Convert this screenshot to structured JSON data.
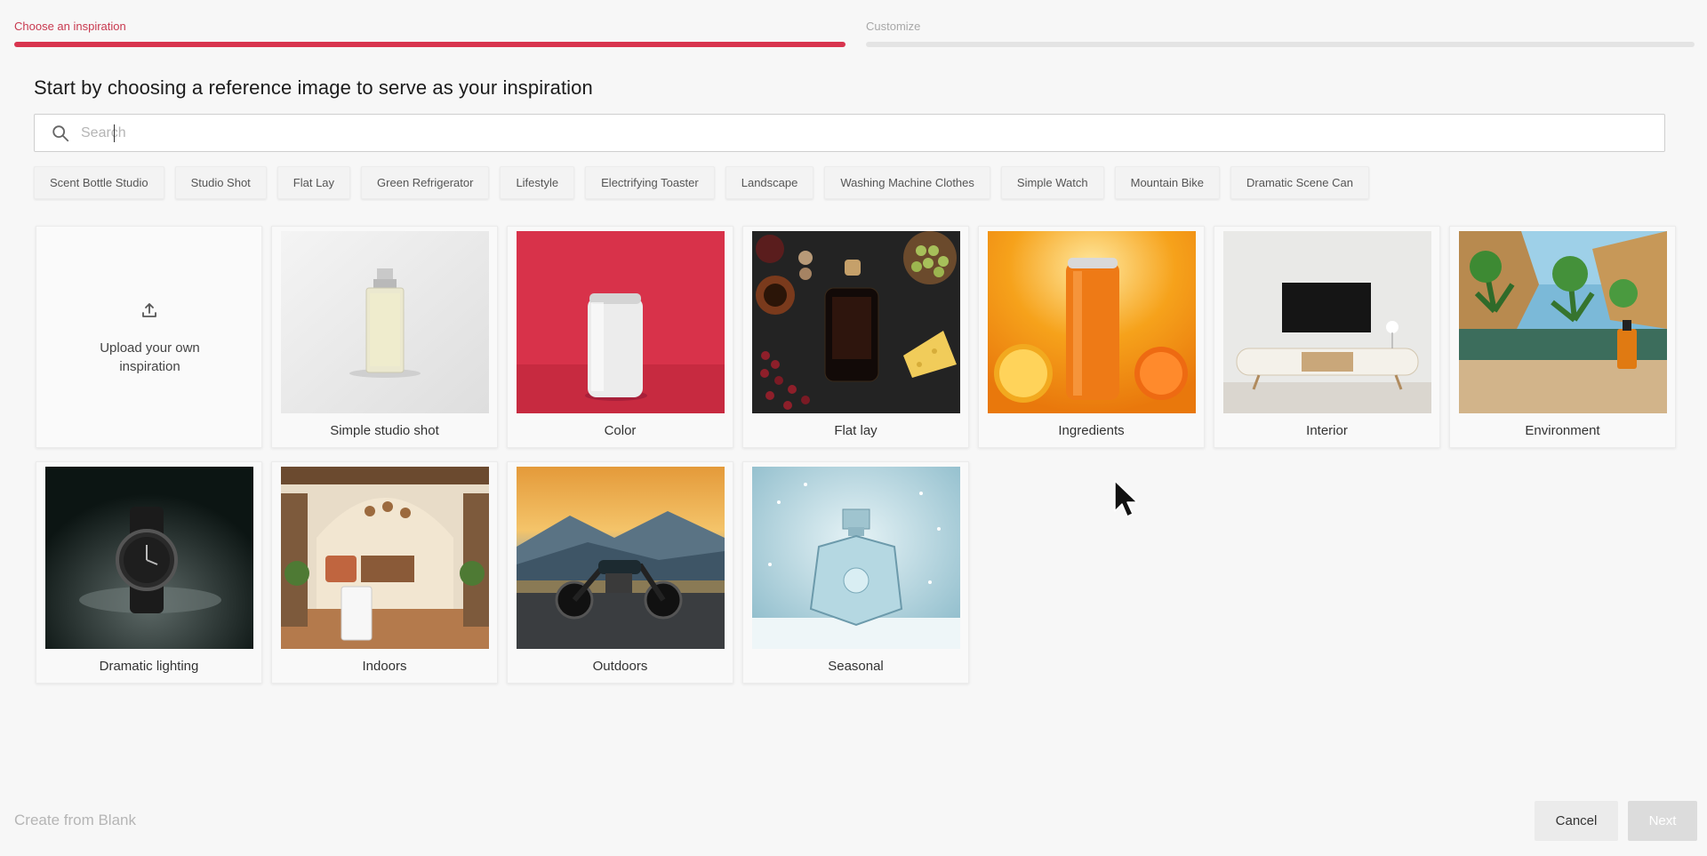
{
  "stepper": {
    "steps": [
      {
        "label": "Choose an inspiration",
        "active": true
      },
      {
        "label": "Customize",
        "active": false
      }
    ]
  },
  "heading": "Start by choosing a reference image to serve as your inspiration",
  "search": {
    "placeholder": "Search",
    "value": ""
  },
  "chips": [
    "Scent Bottle Studio",
    "Studio Shot",
    "Flat Lay",
    "Green Refrigerator",
    "Lifestyle",
    "Electrifying Toaster",
    "Landscape",
    "Washing Machine Clothes",
    "Simple Watch",
    "Mountain Bike",
    "Dramatic Scene Can"
  ],
  "upload": {
    "label": "Upload your own inspiration",
    "icon": "upload-icon"
  },
  "cards": [
    {
      "title": "Simple studio shot",
      "image": "perfume-bottle"
    },
    {
      "title": "Color",
      "image": "can-on-red"
    },
    {
      "title": "Flat lay",
      "image": "flat-lay-food"
    },
    {
      "title": "Ingredients",
      "image": "orange-can"
    },
    {
      "title": "Interior",
      "image": "tv-room"
    },
    {
      "title": "Environment",
      "image": "oasis-bottle"
    },
    {
      "title": "Dramatic lighting",
      "image": "watch"
    },
    {
      "title": "Indoors",
      "image": "living-room"
    },
    {
      "title": "Outdoors",
      "image": "motorcycle"
    },
    {
      "title": "Seasonal",
      "image": "winter-perfume"
    }
  ],
  "footer": {
    "create_blank": "Create from Blank",
    "cancel": "Cancel",
    "next": "Next"
  },
  "colors": {
    "accent": "#d8354f",
    "background": "#f7f7f7",
    "disabled_button": "#dcdcdc"
  }
}
